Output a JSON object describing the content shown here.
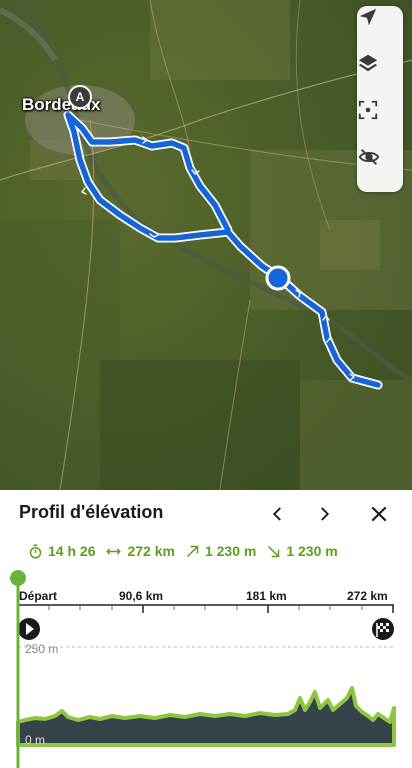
{
  "map": {
    "city_label": "Bordeaux",
    "start_marker": "A",
    "controls": [
      {
        "name": "navigation-arrow-icon"
      },
      {
        "name": "layers-icon"
      },
      {
        "name": "focus-icon"
      },
      {
        "name": "hide-route-icon"
      }
    ]
  },
  "panel": {
    "title": "Profil d'élévation",
    "stats": {
      "duration": "14 h 26",
      "distance": "272 km",
      "ascent": "1 230 m",
      "descent": "1 230 m"
    },
    "distance_labels": {
      "start": "Départ",
      "mark1": "90,6 km",
      "mark2": "181 km",
      "end": "272 km"
    },
    "elevation_labels": {
      "top": "250 m",
      "bottom": "0 m"
    }
  },
  "colors": {
    "route": "#1565d8",
    "accent_green": "#5e9e1c",
    "profile_fill": "#37434a",
    "profile_line": "#8dc63f"
  }
}
